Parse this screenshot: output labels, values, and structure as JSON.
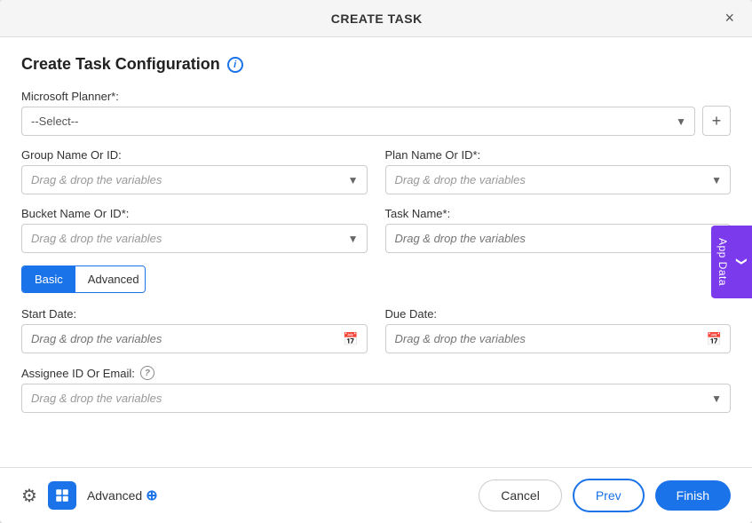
{
  "modal": {
    "header_title": "CREATE TASK",
    "close_label": "×"
  },
  "config": {
    "title": "Create Task Configuration",
    "info_icon": "i"
  },
  "fields": {
    "ms_planner_label": "Microsoft Planner*:",
    "ms_planner_placeholder": "--Select--",
    "ms_planner_plus": "+",
    "group_name_label": "Group Name Or ID:",
    "group_name_placeholder": "Drag & drop the variables",
    "plan_name_label": "Plan Name Or ID*:",
    "plan_name_placeholder": "Drag & drop the variables",
    "bucket_name_label": "Bucket Name Or ID*:",
    "bucket_name_placeholder": "Drag & drop the variables",
    "task_name_label": "Task Name*:",
    "task_name_placeholder": "Drag & drop the variables",
    "start_date_label": "Start Date:",
    "start_date_placeholder": "Drag & drop the variables",
    "due_date_label": "Due Date:",
    "due_date_placeholder": "Drag & drop the variables",
    "assignee_label": "Assignee ID Or Email:",
    "assignee_placeholder": "Drag & drop the variables"
  },
  "tabs": {
    "basic_label": "Basic",
    "advanced_label": "Advanced"
  },
  "footer": {
    "gear_icon": "⚙",
    "advanced_label": "Advanced",
    "cancel_label": "Cancel",
    "prev_label": "Prev",
    "finish_label": "Finish"
  },
  "side_tab": {
    "label": "App Data",
    "arrow": "❮"
  }
}
